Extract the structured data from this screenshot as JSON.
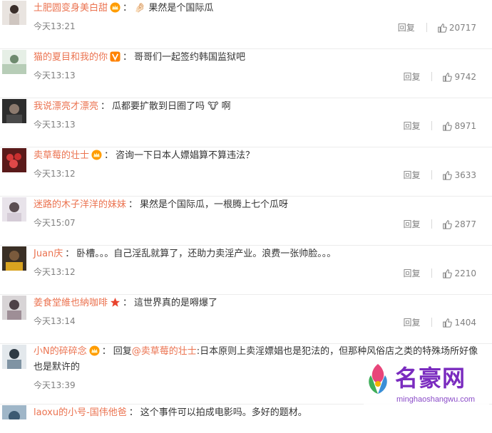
{
  "comments": [
    {
      "user": "土肥圆变身美白甜",
      "badge": "crown-icon",
      "text": "🤌🏻 果然是个国际瓜",
      "time": "今天13:21",
      "reply": "回复",
      "likes": "20717"
    },
    {
      "user": "猫的夏目和我的你",
      "badge": "vip-icon",
      "text": "哥哥们一起签约韩国监狱吧",
      "time": "今天13:13",
      "reply": "回复",
      "likes": "9742"
    },
    {
      "user": "我说漂亮才漂亮",
      "badge": "",
      "text": "瓜都要扩散到日圈了吗 🐮 啊",
      "time": "今天13:13",
      "reply": "回复",
      "likes": "8971"
    },
    {
      "user": "卖草莓的壮士",
      "badge": "crown-icon",
      "text": "咨询一下日本人嫖娼算不算违法？",
      "time": "今天13:12",
      "reply": "回复",
      "likes": "3633"
    },
    {
      "user": "迷路的木子洋洋的妹妹",
      "badge": "",
      "text": "果然是个国际瓜，一根腾上七个瓜呀",
      "time": "今天15:07",
      "reply": "回复",
      "likes": "2877"
    },
    {
      "user": "Juan庆",
      "badge": "",
      "text": "卧槽。。。自己淫乱就算了，还助力卖淫产业。浪费一张帅脸。。。",
      "time": "今天13:12",
      "reply": "回复",
      "likes": "2210"
    },
    {
      "user": "姜食堂維也納咖啡",
      "badge": "star-icon",
      "text": "這世界真的是嘚爆了",
      "time": "今天13:14",
      "reply": "回复",
      "likes": "1404"
    },
    {
      "user": "小N的碎碎念",
      "badge": "crown-icon",
      "reply_prefix": "回复",
      "mention": "@卖草莓的壮士",
      "text": ":日本原则上卖淫嫖娼也是犯法的，但那种风俗店之类的特殊场所好像也是默许的",
      "time": "今天13:39",
      "reply": "回复",
      "likes": ""
    },
    {
      "user": "laoxu的小号-国伟他爸",
      "badge": "",
      "text": "这个事件可以拍成电影吗。多好的题材。",
      "time": "",
      "reply": "",
      "likes": ""
    }
  ],
  "watermark": {
    "name": "名豪网",
    "url": "minghaoshangwu.com"
  },
  "colors": {
    "username": "#eb7350",
    "meta": "#808080",
    "watermark": "#7a2bbf"
  }
}
